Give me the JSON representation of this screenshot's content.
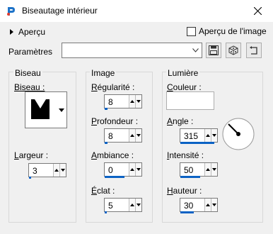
{
  "window": {
    "title": "Biseautage intérieur",
    "app_icon": "psp-paintbrush-icon"
  },
  "preview": {
    "toggle_label": "Aperçu",
    "checkbox_label": "Aperçu de l'image",
    "checked": false
  },
  "params": {
    "label": "Paramètres",
    "value": ""
  },
  "groups": {
    "biseau": {
      "title": "Biseau",
      "bevel_label": "Biseau :",
      "width_label": "Largeur :",
      "width_value": "3"
    },
    "image": {
      "title": "Image",
      "smoothness_label": "Régularité :",
      "smoothness_value": "8",
      "depth_label": "Profondeur :",
      "depth_value": "8",
      "ambience_label": "Ambiance :",
      "ambience_value": "0",
      "shininess_label": "Éclat :",
      "shininess_value": "5"
    },
    "light": {
      "title": "Lumière",
      "color_label": "Couleur :",
      "color_value": "#ffffff",
      "angle_label": "Angle :",
      "angle_value": "315",
      "intensity_label": "Intensité :",
      "intensity_value": "50",
      "elevation_label": "Hauteur :",
      "elevation_value": "30"
    }
  }
}
